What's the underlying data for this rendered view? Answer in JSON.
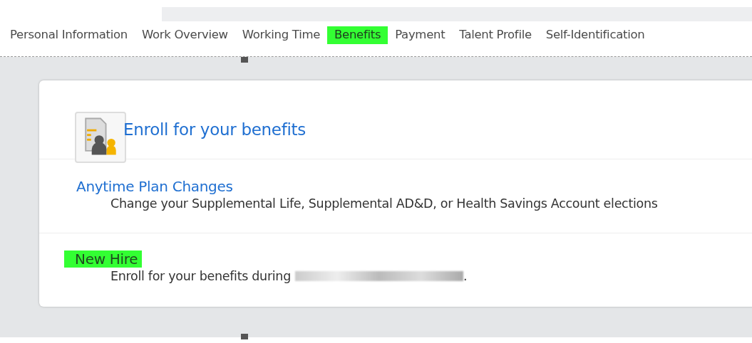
{
  "tabs": [
    {
      "label": "Personal Information",
      "highlighted": false
    },
    {
      "label": "Work Overview",
      "highlighted": false
    },
    {
      "label": "Working Time",
      "highlighted": false
    },
    {
      "label": "Benefits",
      "highlighted": true
    },
    {
      "label": "Payment",
      "highlighted": false
    },
    {
      "label": "Talent Profile",
      "highlighted": false
    },
    {
      "label": "Self-Identification",
      "highlighted": false
    }
  ],
  "card": {
    "title": "Enroll for your benefits",
    "sections": [
      {
        "title": "Anytime Plan Changes",
        "highlighted": false,
        "description": "Change your Supplemental Life, Supplemental AD&D, or Health Savings Account elections",
        "redacted": false
      },
      {
        "title": "New Hire",
        "highlighted": true,
        "description": "Enroll for your benefits during",
        "redacted": true,
        "description_end": "."
      }
    ]
  }
}
